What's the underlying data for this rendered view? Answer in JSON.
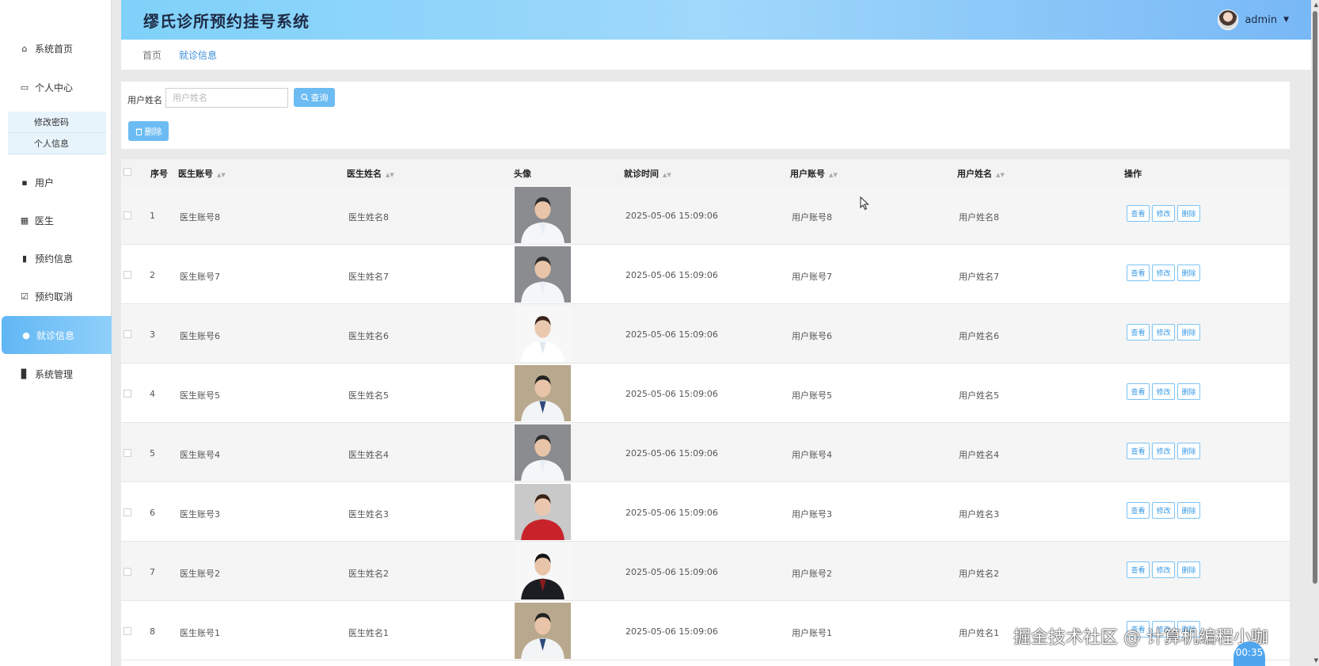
{
  "header": {
    "title": "缪氏诊所预约挂号系统",
    "username": "admin"
  },
  "sidebar": {
    "items": [
      {
        "label": "系统首页",
        "icon": "home-icon"
      },
      {
        "label": "个人中心",
        "icon": "card-icon"
      },
      {
        "label": "用户",
        "icon": "briefcase-icon"
      },
      {
        "label": "医生",
        "icon": "grid-icon"
      },
      {
        "label": "预约信息",
        "icon": "clipboard-icon"
      },
      {
        "label": "预约取消",
        "icon": "checkbox-icon"
      },
      {
        "label": "就诊信息",
        "icon": "thumbs-up-icon"
      },
      {
        "label": "系统管理",
        "icon": "bar-chart-icon"
      }
    ],
    "subitems": [
      {
        "label": "修改密码"
      },
      {
        "label": "个人信息"
      }
    ]
  },
  "breadcrumb": {
    "home": "首页",
    "current": "就诊信息"
  },
  "search": {
    "label": "用户姓名",
    "placeholder": "用户姓名",
    "query_label": "查询",
    "delete_label": "删除"
  },
  "table": {
    "headers": [
      "序号",
      "医生账号",
      "医生姓名",
      "头像",
      "就诊时间",
      "用户账号",
      "用户姓名",
      "操作"
    ],
    "actions": [
      "查看",
      "修改",
      "删除"
    ],
    "rows": [
      {
        "index": "1",
        "doctor_account": "医生账号8",
        "doctor_name": "医生姓名8",
        "time": "2025-05-06 15:09:06",
        "user_account": "用户账号8",
        "user_name": "用户姓名8"
      },
      {
        "index": "2",
        "doctor_account": "医生账号7",
        "doctor_name": "医生姓名7",
        "time": "2025-05-06 15:09:06",
        "user_account": "用户账号7",
        "user_name": "用户姓名7"
      },
      {
        "index": "3",
        "doctor_account": "医生账号6",
        "doctor_name": "医生姓名6",
        "time": "2025-05-06 15:09:06",
        "user_account": "用户账号6",
        "user_name": "用户姓名6"
      },
      {
        "index": "4",
        "doctor_account": "医生账号5",
        "doctor_name": "医生姓名5",
        "time": "2025-05-06 15:09:06",
        "user_account": "用户账号5",
        "user_name": "用户姓名5"
      },
      {
        "index": "5",
        "doctor_account": "医生账号4",
        "doctor_name": "医生姓名4",
        "time": "2025-05-06 15:09:06",
        "user_account": "用户账号4",
        "user_name": "用户姓名4"
      },
      {
        "index": "6",
        "doctor_account": "医生账号3",
        "doctor_name": "医生姓名3",
        "time": "2025-05-06 15:09:06",
        "user_account": "用户账号3",
        "user_name": "用户姓名3"
      },
      {
        "index": "7",
        "doctor_account": "医生账号2",
        "doctor_name": "医生姓名2",
        "time": "2025-05-06 15:09:06",
        "user_account": "用户账号2",
        "user_name": "用户姓名2"
      },
      {
        "index": "8",
        "doctor_account": "医生账号1",
        "doctor_name": "医生姓名1",
        "time": "2025-05-06 15:09:06",
        "user_account": "用户账号1",
        "user_name": "用户姓名1"
      }
    ]
  },
  "overlay": {
    "watermark": "掘金技术社区 @ 计算机编程小咖",
    "timer": "00:35"
  },
  "colors": {
    "accent": "#6cbcf3",
    "header_start": "#7fd1f9",
    "header_end": "#78b8f6",
    "link": "#3a8ed8"
  }
}
